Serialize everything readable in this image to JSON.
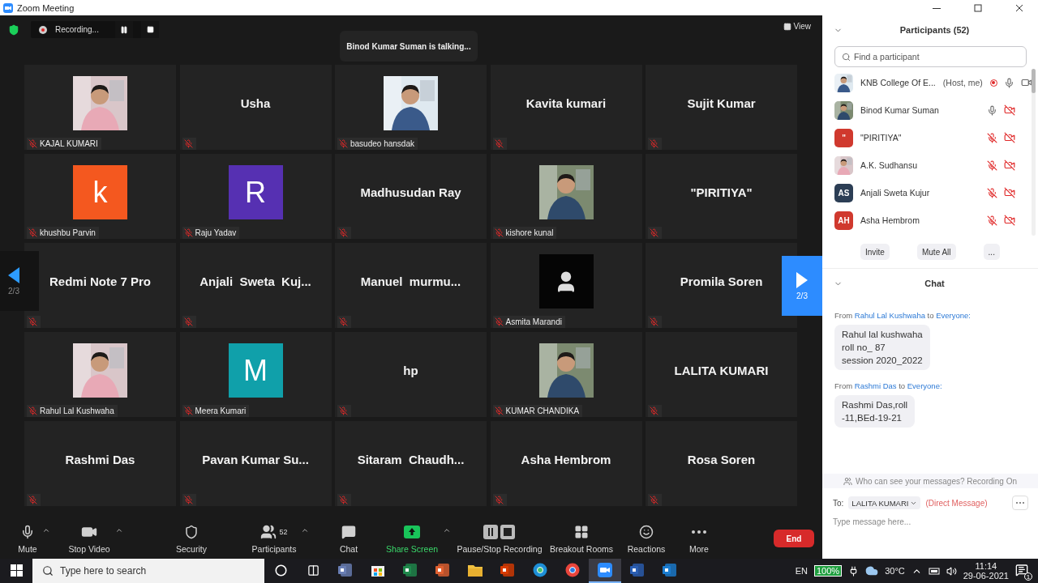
{
  "window": {
    "title": "Zoom Meeting"
  },
  "recording": {
    "label": "Recording..."
  },
  "talking": "Binod Kumar Suman is talking...",
  "view_button": "View",
  "pager": {
    "left": "2/3",
    "right": "2/3"
  },
  "tiles": [
    {
      "kind": "picture",
      "name": "KAJAL KUMARI",
      "muted": true
    },
    {
      "kind": "name",
      "name": "Usha",
      "muted": true
    },
    {
      "kind": "picture",
      "name": "basudeo hansdak",
      "muted": true
    },
    {
      "kind": "name",
      "name": "Kavita kumari",
      "muted": true
    },
    {
      "kind": "name",
      "name": "Sujit Kumar",
      "muted": true
    },
    {
      "kind": "avatar",
      "letter": "k",
      "color": "#f4581f",
      "name": "khushbu Parvin",
      "muted": true
    },
    {
      "kind": "avatar",
      "letter": "R",
      "color": "#5630b2",
      "name": "Raju Yadav",
      "muted": true
    },
    {
      "kind": "name",
      "name": "Madhusudan Ray",
      "muted": true
    },
    {
      "kind": "picture",
      "name": "kishore kunal",
      "muted": true
    },
    {
      "kind": "name",
      "name": "\"PIRITIYA\"",
      "muted": true
    },
    {
      "kind": "name",
      "name": "Redmi Note 7 Pro",
      "muted": true
    },
    {
      "kind": "name",
      "name": "Anjali  Sweta  Kuj...",
      "muted": true
    },
    {
      "kind": "name",
      "name": "Manuel  murmu...",
      "muted": true
    },
    {
      "kind": "silhouette",
      "name": "Asmita Marandi",
      "muted": true
    },
    {
      "kind": "name",
      "name": "Promila Soren",
      "muted": true
    },
    {
      "kind": "picture",
      "name": "Rahul Lal Kushwaha",
      "muted": true
    },
    {
      "kind": "avatar",
      "letter": "M",
      "color": "#10a0aa",
      "name": "Meera Kumari",
      "muted": true
    },
    {
      "kind": "name",
      "name": "hp",
      "muted": true
    },
    {
      "kind": "picture",
      "name": "KUMAR CHANDIKA",
      "muted": true
    },
    {
      "kind": "name",
      "name": "LALITA KUMARI",
      "muted": true
    },
    {
      "kind": "name",
      "name": "Rashmi Das",
      "muted": true
    },
    {
      "kind": "name",
      "name": "Pavan Kumar Su...",
      "muted": true
    },
    {
      "kind": "name",
      "name": "Sitaram  Chaudh...",
      "muted": true
    },
    {
      "kind": "name",
      "name": "Asha Hembrom",
      "muted": true
    },
    {
      "kind": "name",
      "name": "Rosa Soren",
      "muted": true
    }
  ],
  "toolbar": {
    "items": [
      {
        "kind": "mute",
        "label": "Mute",
        "caret": true
      },
      {
        "kind": "video",
        "label": "Stop Video",
        "caret": true
      },
      {
        "kind": "security",
        "label": "Security",
        "caret": false
      },
      {
        "kind": "participants",
        "label": "Participants",
        "count": "52",
        "caret": true
      },
      {
        "kind": "chat",
        "label": "Chat",
        "caret": false
      },
      {
        "kind": "share",
        "label": "Share Screen",
        "caret": true
      },
      {
        "kind": "record",
        "label": "Pause/Stop Recording",
        "caret": false
      },
      {
        "kind": "breakout",
        "label": "Breakout Rooms",
        "caret": false
      },
      {
        "kind": "reactions",
        "label": "Reactions",
        "caret": false
      },
      {
        "kind": "more",
        "label": "More",
        "caret": false
      }
    ],
    "end": "End"
  },
  "participants": {
    "title": "Participants (52)",
    "search_placeholder": "Find a participant",
    "rows": [
      {
        "name": "KNB College Of E...",
        "note": "(Host, me)",
        "recording": true,
        "mic_muted": false,
        "video_on": true
      },
      {
        "name": "Binod Kumar Suman",
        "recording": false,
        "mic_muted": false,
        "video_on": false
      },
      {
        "name": "\"PIRITIYA\"",
        "recording": false,
        "avatar": {
          "kind": "initials",
          "text": "\"",
          "color": "#d0392e"
        },
        "mic_muted": true,
        "video_on": false
      },
      {
        "name": "A.K. Sudhansu",
        "recording": false,
        "mic_muted": true,
        "video_on": false
      },
      {
        "name": "Anjali Sweta Kujur",
        "recording": false,
        "avatar": {
          "kind": "initials",
          "text": "AS",
          "color": "#2c3e55"
        },
        "mic_muted": true,
        "video_on": false
      },
      {
        "name": "Asha Hembrom",
        "recording": false,
        "avatar": {
          "kind": "initials",
          "text": "AH",
          "color": "#d0392e"
        },
        "mic_muted": true,
        "video_on": false
      }
    ],
    "buttons": [
      "Invite",
      "Mute All",
      "..."
    ]
  },
  "chat": {
    "title": "Chat",
    "messages": [
      {
        "from_label": "From",
        "sender": "Rahul Lal Kushwaha",
        "to_label": "to",
        "recipient": "Everyone:",
        "lines": [
          "Rahul lal kushwaha",
          "roll no_ 87",
          "session 2020_2022"
        ]
      },
      {
        "from_label": "From",
        "sender": "Rashmi Das",
        "to_label": "to",
        "recipient": "Everyone:",
        "lines": [
          "Rashmi Das,roll",
          "-11,BEd-19-21"
        ]
      }
    ],
    "notice": "Who can see your messages? Recording On",
    "to_label": "To:",
    "recipient": "LALITA KUMARI",
    "direct": "(Direct Message)",
    "placeholder": "Type message here..."
  },
  "taskbar": {
    "search_placeholder": "Type here to search",
    "apps": [
      {
        "kind": "photos",
        "selected": false
      },
      {
        "kind": "store",
        "selected": false
      },
      {
        "kind": "excel",
        "selected": false
      },
      {
        "kind": "slides",
        "selected": false
      },
      {
        "kind": "explorer",
        "selected": false
      },
      {
        "kind": "office",
        "selected": false
      },
      {
        "kind": "edge",
        "selected": false
      },
      {
        "kind": "chrome",
        "selected": false
      },
      {
        "kind": "zoom",
        "selected": true
      },
      {
        "kind": "word",
        "selected": false
      },
      {
        "kind": "media",
        "selected": false
      }
    ],
    "language": "EN",
    "battery": "100%",
    "weather": "30°C",
    "time": "11:14",
    "date": "29-06-2021",
    "notifications": "1"
  }
}
